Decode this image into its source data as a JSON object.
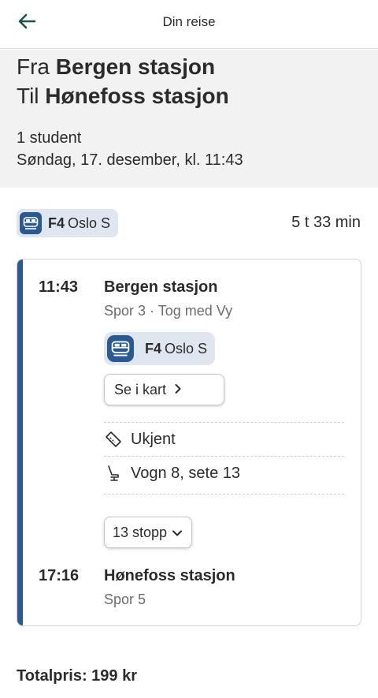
{
  "header": {
    "title": "Din reise",
    "back_icon": "arrow-left-icon",
    "accent_color": "#1f5246"
  },
  "summary": {
    "from_prefix": "Fra",
    "from_name": "Bergen stasjon",
    "to_prefix": "Til",
    "to_name": "Hønefoss stasjon",
    "passengers": "1 student",
    "datetime": "Søndag, 17. desember, kl. 11:43"
  },
  "journey": {
    "line_code": "F4",
    "line_destination": "Oslo S",
    "duration": "5 t 33 min",
    "line_color": "#2a5a91",
    "chip_color": "#dfe6ef"
  },
  "leg": {
    "departure": {
      "time": "11:43",
      "station": "Bergen stasjon",
      "details": "Spor 3 · Tog med Vy"
    },
    "line_code": "F4",
    "line_destination": "Oslo S",
    "map_button": "Se i kart",
    "ticket_status": "Ukjent",
    "seat": "Vogn 8, sete 13",
    "stops_button": "13 stopp",
    "arrival": {
      "time": "17:16",
      "station": "Hønefoss stasjon",
      "details": "Spor 5"
    }
  },
  "footer": {
    "total": "Totalpris: 199 kr"
  }
}
